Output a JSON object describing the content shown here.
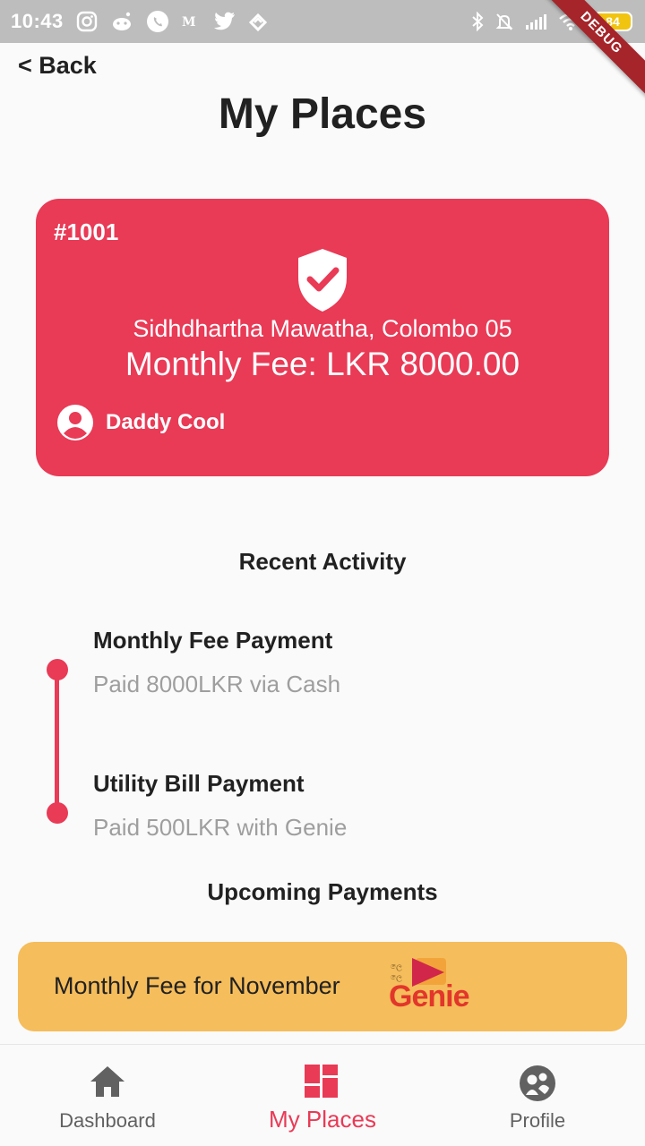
{
  "status_bar": {
    "time": "10:43",
    "battery": "84",
    "left_icons": [
      "instagram-icon",
      "reddit-icon",
      "whatsapp-icon",
      "medium-icon",
      "twitter-icon",
      "feedly-icon"
    ],
    "right_icons": [
      "bluetooth-icon",
      "mute-icon",
      "signal-icon",
      "wifi-icon",
      "battery-icon"
    ]
  },
  "debug_banner": "DEBUG",
  "header": {
    "back_label": "< Back",
    "title": "My Places"
  },
  "place_card": {
    "id": "#1001",
    "address": "Sidhdhartha Mawatha, Colombo 05",
    "fee": "Monthly Fee: LKR 8000.00",
    "owner": "Daddy Cool",
    "color": "#e93a56"
  },
  "recent_activity": {
    "title": "Recent Activity",
    "items": [
      {
        "title": "Monthly Fee Payment",
        "desc": "Paid 8000LKR via Cash"
      },
      {
        "title": "Utility Bill Payment",
        "desc": "Paid 500LKR with Genie"
      }
    ]
  },
  "upcoming": {
    "title": "Upcoming Payments",
    "items": [
      {
        "label": "Monthly Fee for November",
        "logo_text": "Genie",
        "color": "#f5bd5b"
      }
    ]
  },
  "bottom_nav": {
    "items": [
      {
        "label": "Dashboard",
        "icon": "home-icon"
      },
      {
        "label": "My Places",
        "icon": "dashboard-grid-icon",
        "active": true
      },
      {
        "label": "Profile",
        "icon": "people-circle-icon"
      }
    ],
    "active_color": "#e93a56",
    "inactive_color": "#616161"
  }
}
